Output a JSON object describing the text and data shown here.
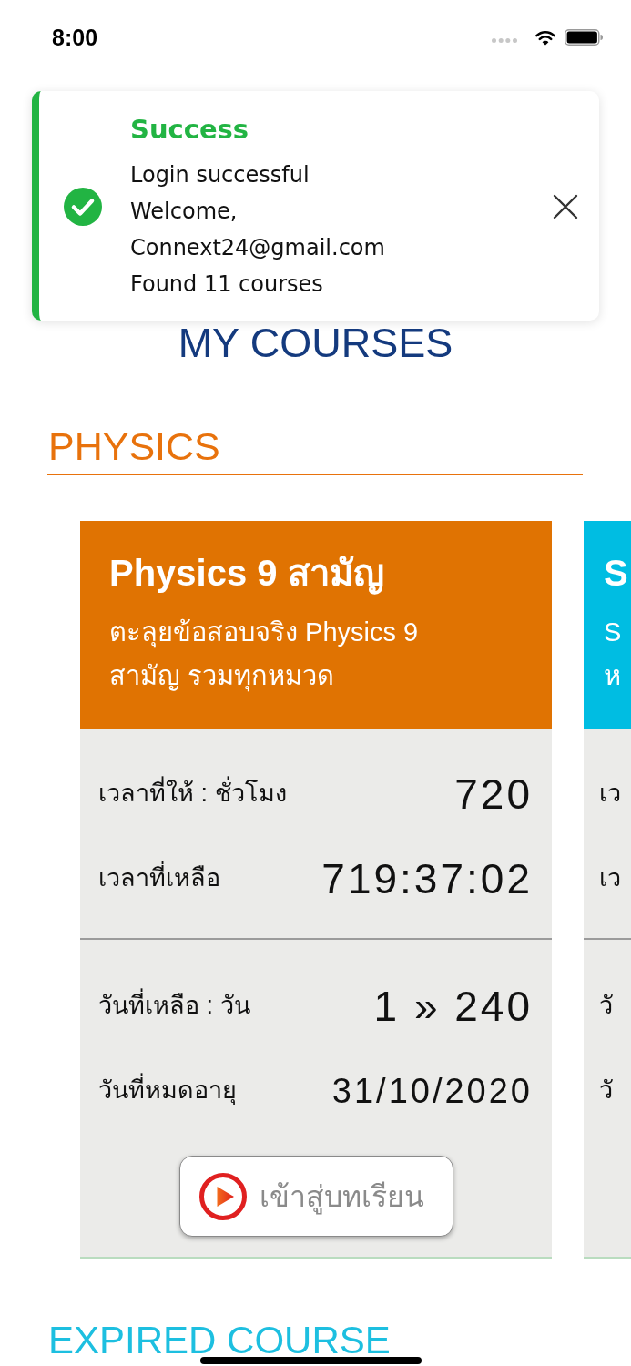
{
  "status_bar": {
    "time": "8:00"
  },
  "toast": {
    "kind": "success",
    "title": "Success",
    "lines": [
      "Login successful",
      "Welcome,",
      "Connext24@gmail.com",
      "Found 11 courses"
    ]
  },
  "page_title": "MY COURSES",
  "sections": [
    {
      "title": "PHYSICS",
      "color": "#e8720c",
      "courses": [
        {
          "title": "Physics 9 สามัญ",
          "subtitle_lines": [
            "ตะลุยข้อสอบจริง Physics 9",
            "สามัญ รวมทุกหมวด"
          ],
          "color": "#e07302",
          "groups": [
            {
              "rows": [
                {
                  "label": "เวลาที่ให้ : ชั่วโมง",
                  "value": "720",
                  "kind": "number"
                },
                {
                  "label": "เวลาที่เหลือ",
                  "value": "719:37:02",
                  "kind": "number"
                }
              ]
            },
            {
              "rows": [
                {
                  "label": "วันที่เหลือ : วัน",
                  "value": "1 » 240",
                  "kind": "number"
                },
                {
                  "label": "วันที่หมดอายุ",
                  "value": "31/10/2020",
                  "kind": "date"
                }
              ]
            }
          ],
          "button": {
            "label": "เข้าสู่บทเรียน"
          }
        },
        {
          "title": "S",
          "subtitle_lines": [
            "S",
            "ห"
          ],
          "color": "#00bde2",
          "groups": [
            {
              "rows": [
                {
                  "label": "เว"
                },
                {
                  "label": "เว"
                }
              ]
            },
            {
              "rows": [
                {
                  "label": "วั"
                },
                {
                  "label": "วั"
                }
              ]
            }
          ]
        }
      ]
    },
    {
      "title": "EXPIRED COURSE",
      "color": "#1dbfe0"
    }
  ]
}
